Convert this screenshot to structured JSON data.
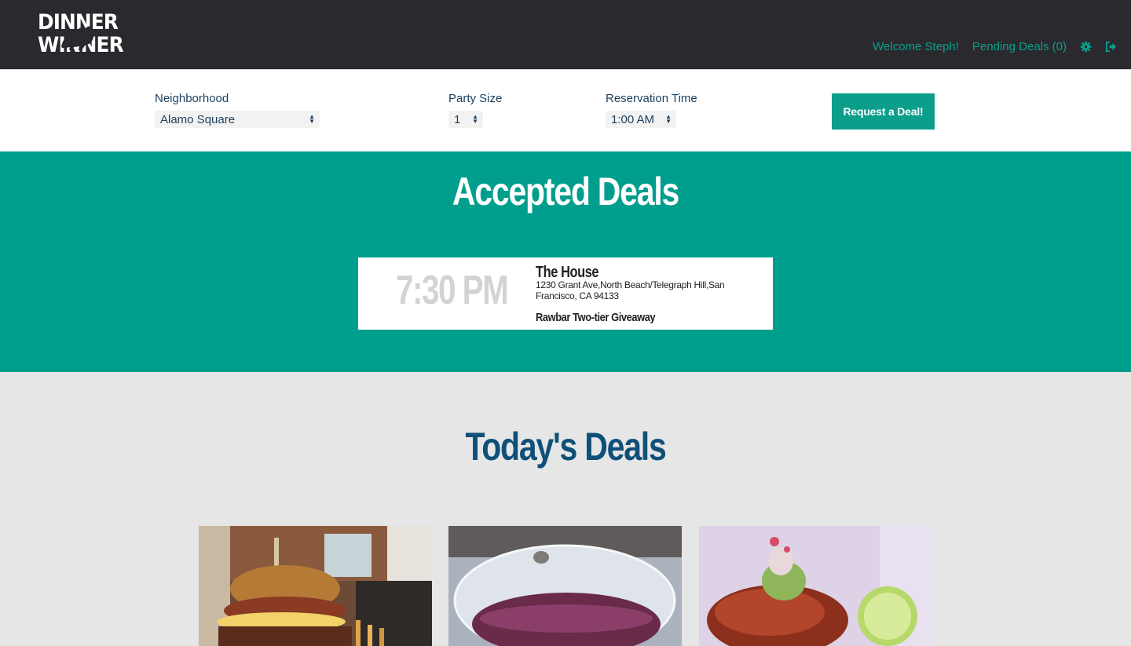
{
  "app": {
    "logo_line1": "DINNER",
    "logo_line2": "WINNER"
  },
  "nav": {
    "welcome": "Welcome Steph!",
    "pending_deals": "Pending Deals (0)",
    "settings_icon": "gear-icon",
    "logout_icon": "sign-out-icon"
  },
  "filters": {
    "neighborhood_label": "Neighborhood",
    "neighborhood_value": "Alamo Square",
    "party_size_label": "Party Size",
    "party_size_value": "1",
    "reservation_time_label": "Reservation Time",
    "reservation_time_value": "1:00 AM",
    "request_button": "Request a Deal!"
  },
  "accepted": {
    "title": "Accepted Deals",
    "deals": [
      {
        "time": "7:30 PM",
        "restaurant": "The House",
        "address": "1230 Grant Ave,North Beach/Telegraph Hill,San Francisco, CA 94133",
        "offer": "Rawbar Two-tier Giveaway"
      }
    ]
  },
  "todays": {
    "title": "Today's Deals",
    "tiles": [
      {
        "image": "burger-photo"
      },
      {
        "image": "wine-glass-photo"
      },
      {
        "image": "grilled-fish-photo"
      }
    ]
  },
  "colors": {
    "navbar": "#2a2a2e",
    "accent_teal": "#009e8c",
    "link_teal": "#0b9e8b",
    "heading_blue": "#0f5078",
    "page_bg": "#e6e6e6"
  }
}
